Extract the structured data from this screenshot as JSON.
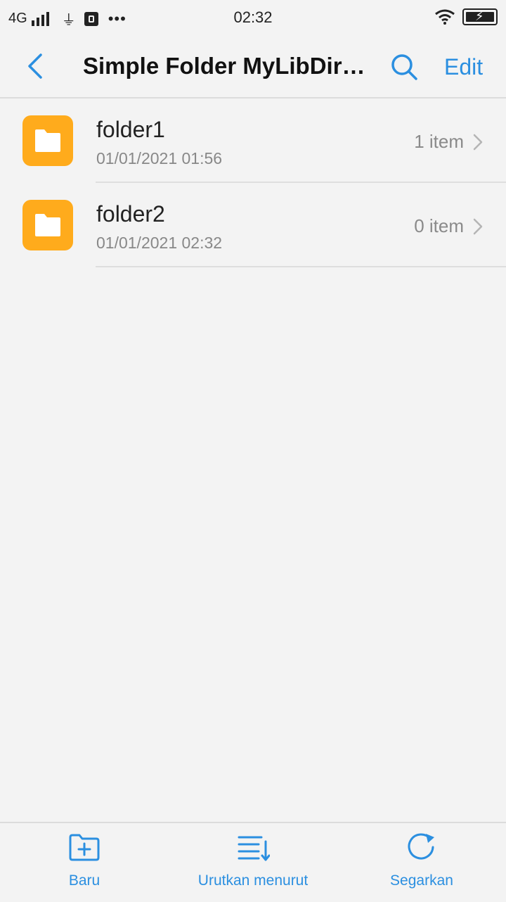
{
  "status_bar": {
    "network": "4G",
    "time": "02:32",
    "more": "•••"
  },
  "header": {
    "title": "Simple Folder MyLibDirectory",
    "edit_label": "Edit"
  },
  "folders": [
    {
      "name": "folder1",
      "date": "01/01/2021 01:56",
      "count": "1 item"
    },
    {
      "name": "folder2",
      "date": "01/01/2021 02:32",
      "count": "0 item"
    }
  ],
  "bottom_nav": {
    "new_label": "Baru",
    "sort_label": "Urutkan menurut",
    "refresh_label": "Segarkan"
  },
  "colors": {
    "accent": "#2b8fe0",
    "folder": "#ffab1c",
    "background": "#f3f3f3"
  }
}
